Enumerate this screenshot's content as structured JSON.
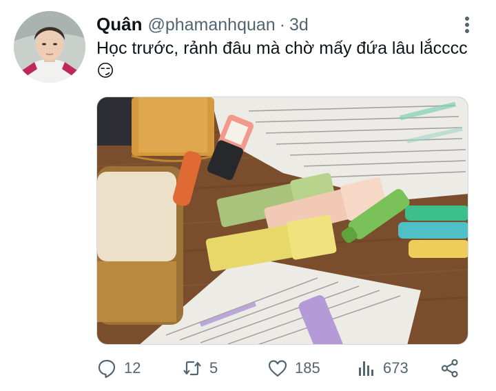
{
  "tweet": {
    "author_name": "Quân",
    "handle": "@phamanhquan",
    "separator": "·",
    "time": "3d",
    "text": "Học trước, rảnh đâu mà chờ mấy đứa lâu lắcccc😏"
  },
  "actions": {
    "reply_count": "12",
    "retweet_count": "5",
    "like_count": "185",
    "view_count": "673"
  },
  "icons": {
    "more": "more-vertical-icon",
    "reply": "reply-icon",
    "retweet": "retweet-icon",
    "like": "heart-icon",
    "views": "views-icon",
    "share": "share-icon"
  },
  "colors": {
    "text_primary": "#0f1419",
    "text_secondary": "#536471"
  }
}
